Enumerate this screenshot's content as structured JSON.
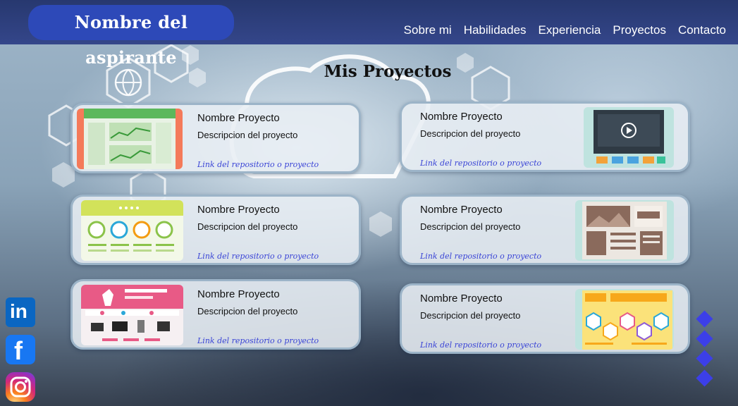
{
  "header": {
    "brand": "Nombre del aspirante",
    "nav": [
      "Sobre mi",
      "Habilidades",
      "Experiencia",
      "Proyectos",
      "Contacto"
    ]
  },
  "section_title": "Mis Proyectos",
  "projects": [
    {
      "name": "Nombre Proyecto",
      "description": "Descripcion del proyecto",
      "link": "Link del repositorio o proyecto",
      "thumbnail": "dashboard-thumbnail"
    },
    {
      "name": "Nombre Proyecto",
      "description": "Descripcion del proyecto",
      "link": "Link del repositorio o proyecto",
      "thumbnail": "video-player-thumbnail"
    },
    {
      "name": "Nombre Proyecto",
      "description": "Descripcion del proyecto",
      "link": "Link del repositorio o proyecto",
      "thumbnail": "icons-webpage-thumbnail"
    },
    {
      "name": "Nombre Proyecto",
      "description": "Descripcion del proyecto",
      "link": "Link del repositorio o proyecto",
      "thumbnail": "news-layout-thumbnail"
    },
    {
      "name": "Nombre Proyecto",
      "description": "Descripcion del proyecto",
      "link": "Link del repositorio o proyecto",
      "thumbnail": "shop-webpage-thumbnail"
    },
    {
      "name": "Nombre Proyecto",
      "description": "Descripcion del proyecto",
      "link": "Link del repositorio o proyecto",
      "thumbnail": "hexagon-infographic-thumbnail"
    }
  ],
  "social": [
    {
      "icon": "linkedin-icon",
      "glyph": "in"
    },
    {
      "icon": "facebook-icon",
      "glyph": "f"
    },
    {
      "icon": "instagram-icon"
    }
  ],
  "colors": {
    "header_bg": "#2b3c78",
    "brand_pill": "#2d49b8",
    "link": "#3a44d6",
    "nav_dots": "#3c3fe8"
  }
}
